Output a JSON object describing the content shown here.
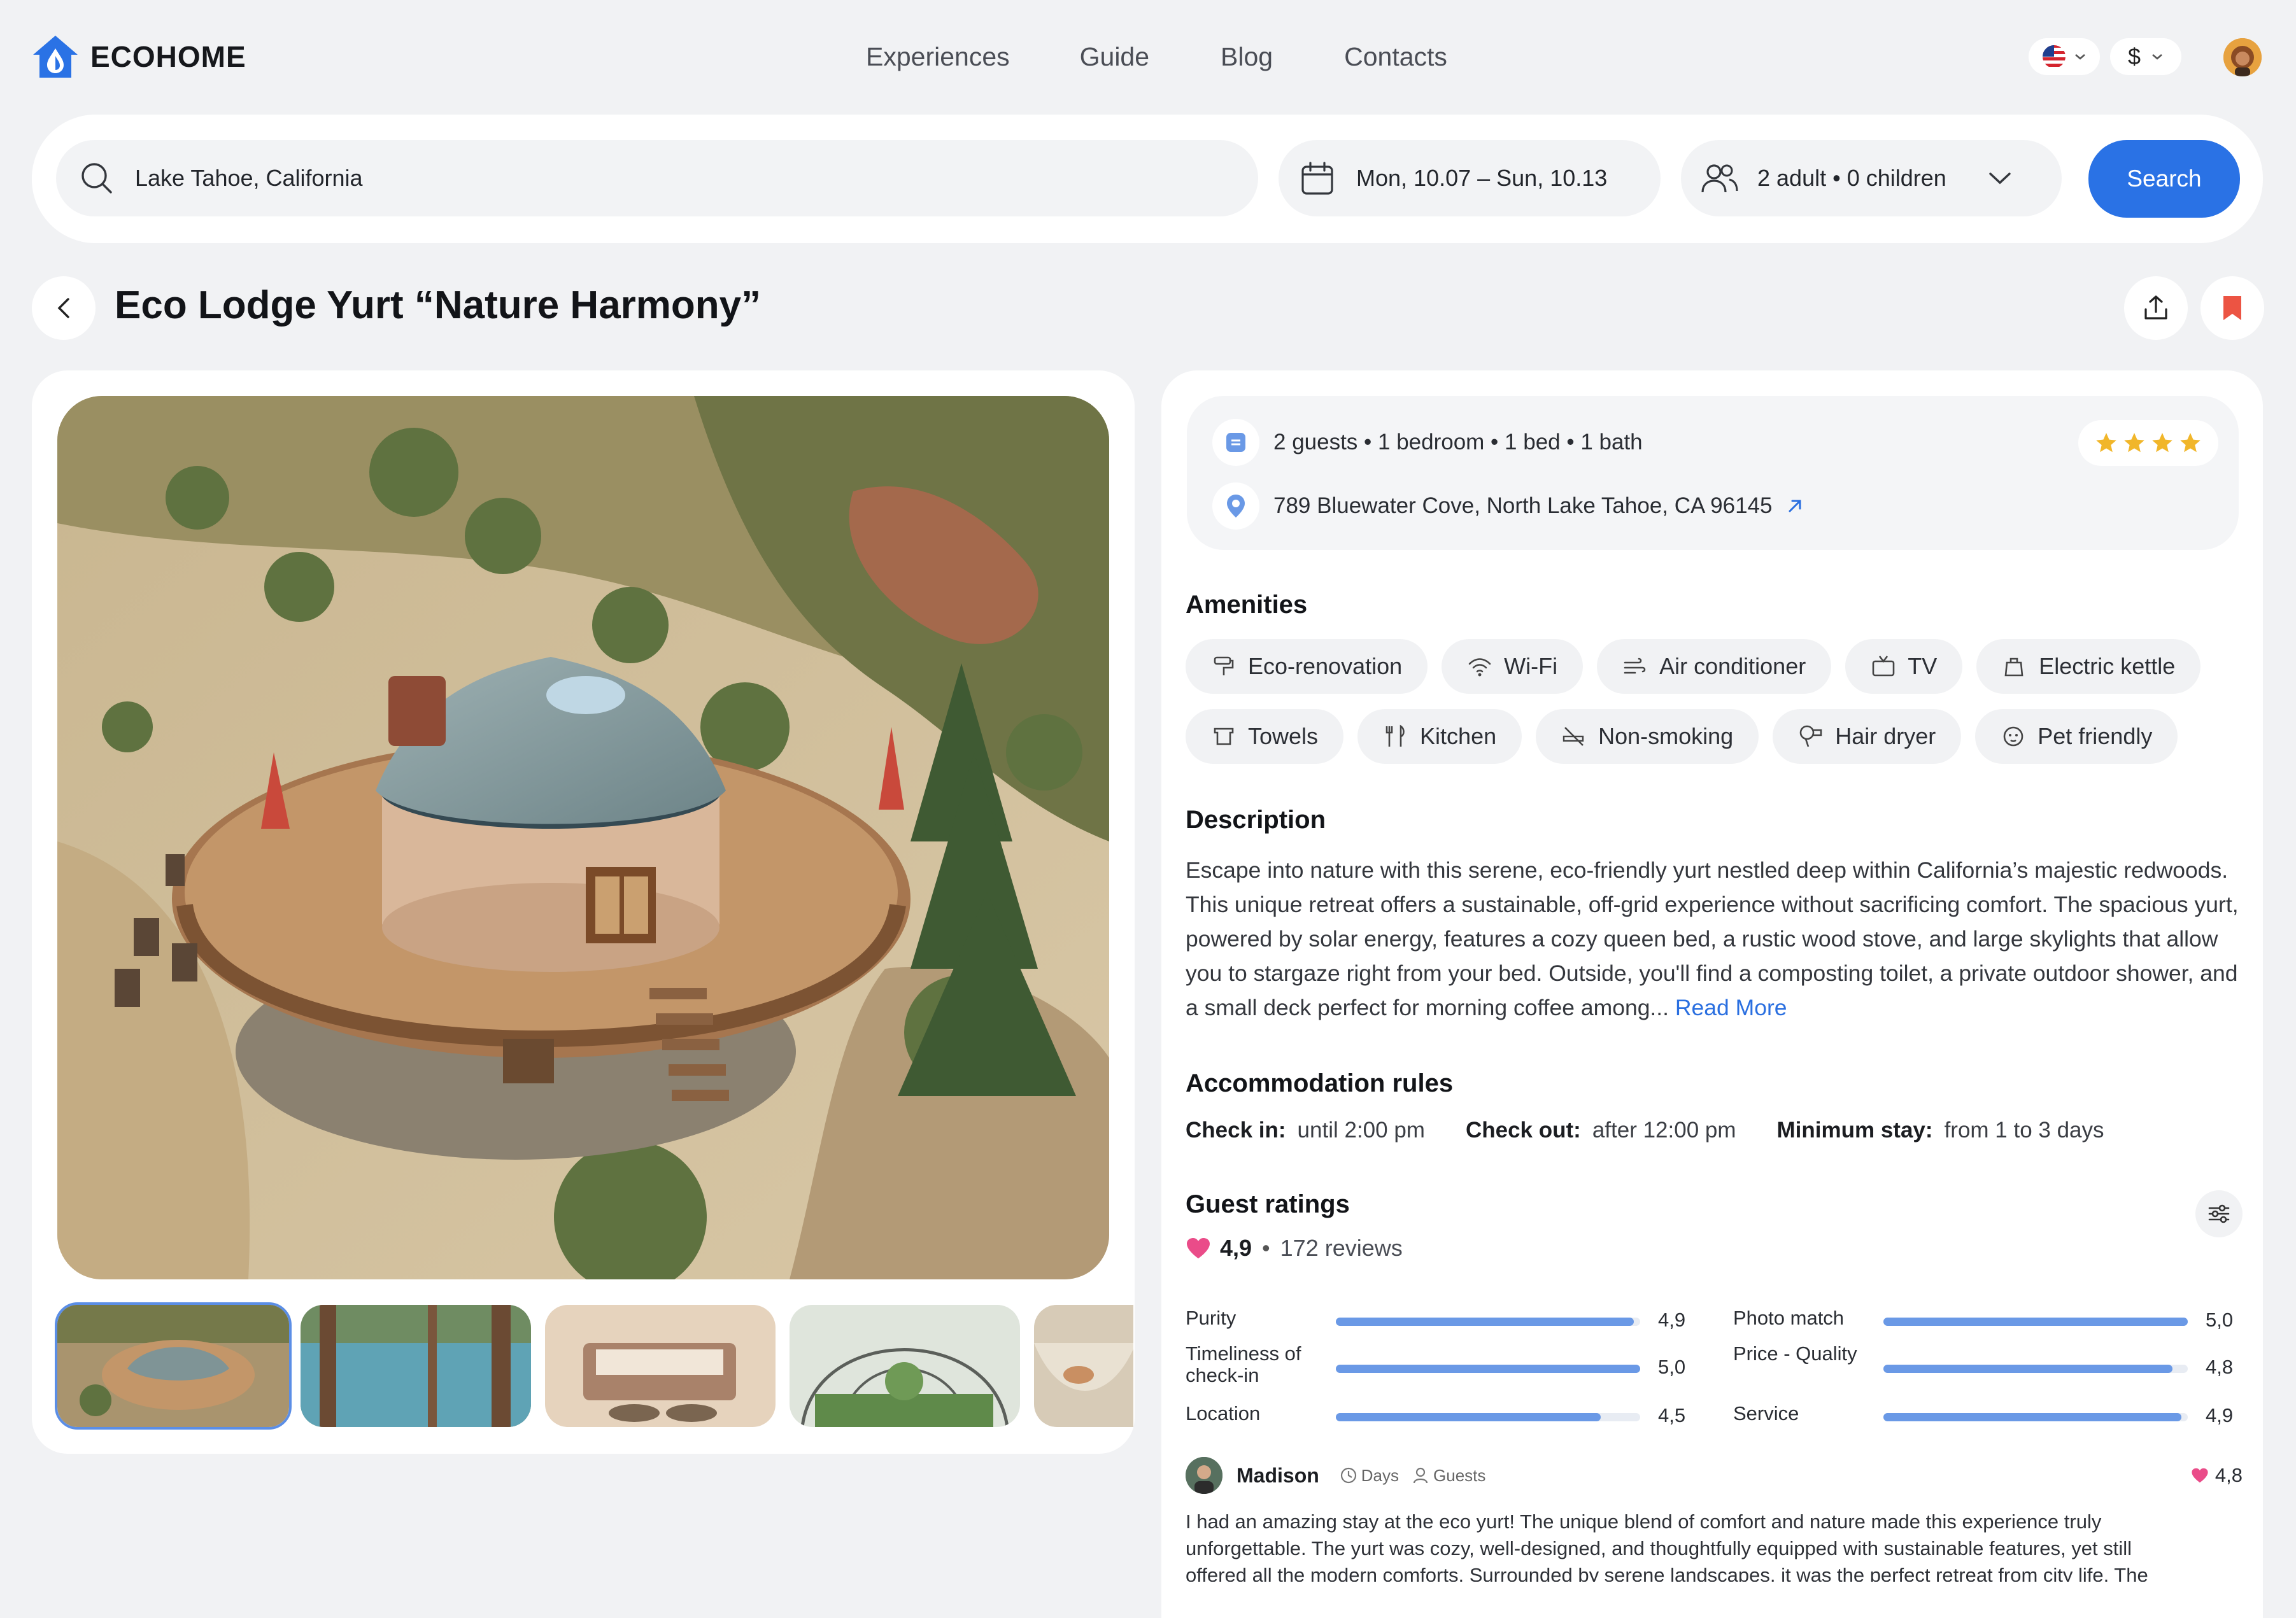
{
  "brand": {
    "name": "ECOHOME",
    "color": "#2a72e5"
  },
  "nav": [
    "Experiences",
    "Guide",
    "Blog",
    "Contacts"
  ],
  "header": {
    "currency": "$",
    "language_icon": "us-flag-icon"
  },
  "search": {
    "location": "Lake Tahoe, California",
    "dates": "Mon, 10.07 – Sun, 10.13",
    "guests": "2 adult • 0 children",
    "button": "Search"
  },
  "listing": {
    "title": "Eco Lodge Yurt “Nature Harmony”",
    "summary": "2 guests • 1 bedroom • 1 bed • 1 bath",
    "address": "789 Bluewater Cove, North Lake Tahoe, CA 96145",
    "stars": 4
  },
  "amenities": {
    "title": "Amenities",
    "items": [
      {
        "label": "Eco-renovation",
        "icon": "paint-roller-icon"
      },
      {
        "label": "Wi-Fi",
        "icon": "wifi-icon"
      },
      {
        "label": "Air conditioner",
        "icon": "wind-icon"
      },
      {
        "label": "TV",
        "icon": "tv-icon"
      },
      {
        "label": "Electric kettle",
        "icon": "kettle-icon"
      },
      {
        "label": "Towels",
        "icon": "towel-icon"
      },
      {
        "label": "Kitchen",
        "icon": "utensils-icon"
      },
      {
        "label": "Non-smoking",
        "icon": "no-smoking-icon"
      },
      {
        "label": "Hair dryer",
        "icon": "hair-dryer-icon"
      },
      {
        "label": "Pet friendly",
        "icon": "paw-icon"
      }
    ]
  },
  "description": {
    "title": "Description",
    "text": "Escape into nature with this serene, eco-friendly yurt nestled deep within California’s majestic redwoods. This unique retreat offers a sustainable, off-grid experience without sacrificing comfort. The spacious yurt, powered by solar energy, features a cozy queen bed, a rustic wood stove, and large skylights that allow you to stargaze right from your bed. Outside, you'll find a composting toilet, a private outdoor shower, and a small deck perfect for morning coffee among...",
    "read_more": "Read More"
  },
  "rules": {
    "title": "Accommodation rules",
    "check_in_label": "Check in:",
    "check_in_value": "until 2:00 pm",
    "check_out_label": "Check out:",
    "check_out_value": "after 12:00 pm",
    "min_stay_label": "Minimum stay:",
    "min_stay_value": "from 1 to 3 days"
  },
  "ratings": {
    "title": "Guest ratings",
    "score": "4,9",
    "reviews": "172 reviews",
    "items": [
      {
        "label": "Purity",
        "value": "4,9",
        "fraction": 0.98
      },
      {
        "label": "Timeliness of check-in",
        "value": "5,0",
        "fraction": 1.0
      },
      {
        "label": "Location",
        "value": "4,5",
        "fraction": 0.87
      },
      {
        "label": "Photo match",
        "value": "5,0",
        "fraction": 1.0
      },
      {
        "label": "Price - Quality",
        "value": "4,8",
        "fraction": 0.95
      },
      {
        "label": "Service",
        "value": "4,9",
        "fraction": 0.98
      }
    ]
  },
  "review": {
    "author": "Madison",
    "days": "Days",
    "guests": "Guests",
    "score": "4,8",
    "text": "I had an amazing stay at the eco yurt! The unique blend of comfort and nature made this experience truly unforgettable. The yurt was cozy, well-designed, and thoughtfully equipped with sustainable features, yet still offered all the modern comforts. Surrounded by serene landscapes, it was the perfect retreat from city life. The"
  }
}
